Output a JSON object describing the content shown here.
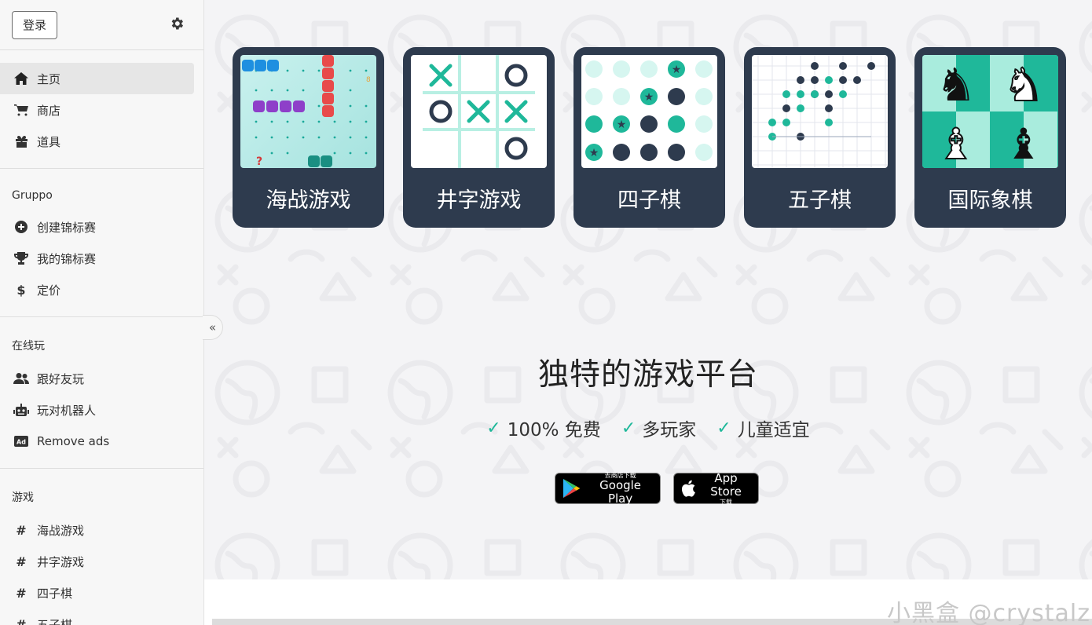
{
  "sidebar": {
    "login_label": "登录",
    "main_nav": [
      {
        "label": "主页",
        "icon": "home-icon",
        "active": true
      },
      {
        "label": "商店",
        "icon": "cart-icon",
        "active": false
      },
      {
        "label": "道具",
        "icon": "gift-icon",
        "active": false
      }
    ],
    "gruppo": {
      "heading": "Gruppo",
      "items": [
        {
          "label": "创建锦标赛",
          "icon": "plus-circle-icon"
        },
        {
          "label": "我的锦标赛",
          "icon": "trophy-icon"
        },
        {
          "label": "定价",
          "icon": "dollar-icon"
        }
      ]
    },
    "online": {
      "heading": "在线玩",
      "items": [
        {
          "label": "跟好友玩",
          "icon": "users-icon"
        },
        {
          "label": "玩对机器人",
          "icon": "robot-icon"
        },
        {
          "label": "Remove ads",
          "icon": "ad-icon"
        }
      ]
    },
    "games": {
      "heading": "游戏",
      "items": [
        {
          "label": "海战游戏",
          "icon": "hash-icon"
        },
        {
          "label": "井字游戏",
          "icon": "hash-icon"
        },
        {
          "label": "四子棋",
          "icon": "hash-icon"
        },
        {
          "label": "五子棋",
          "icon": "hash-icon"
        }
      ]
    },
    "collapse_glyph": "«"
  },
  "cards": [
    {
      "title": "海战游戏",
      "image": "battleship-preview"
    },
    {
      "title": "井字游戏",
      "image": "tictactoe-preview"
    },
    {
      "title": "四子棋",
      "image": "connect-four-preview"
    },
    {
      "title": "五子棋",
      "image": "gomoku-preview"
    },
    {
      "title": "国际象棋",
      "image": "chess-preview"
    }
  ],
  "hero": {
    "title": "独特的游戏平台",
    "features": [
      "100% 免费",
      "多玩家",
      "儿童适宜"
    ],
    "google_play": {
      "small": "去商店下载",
      "big": "Google Play"
    },
    "app_store": {
      "small": "下载",
      "big": "App Store"
    }
  },
  "watermark": "小黑盒 @crystalz",
  "colors": {
    "card_bg": "#2e3b4e",
    "accent": "#1fb89a",
    "sidebar_bg": "#f7f7f7"
  }
}
